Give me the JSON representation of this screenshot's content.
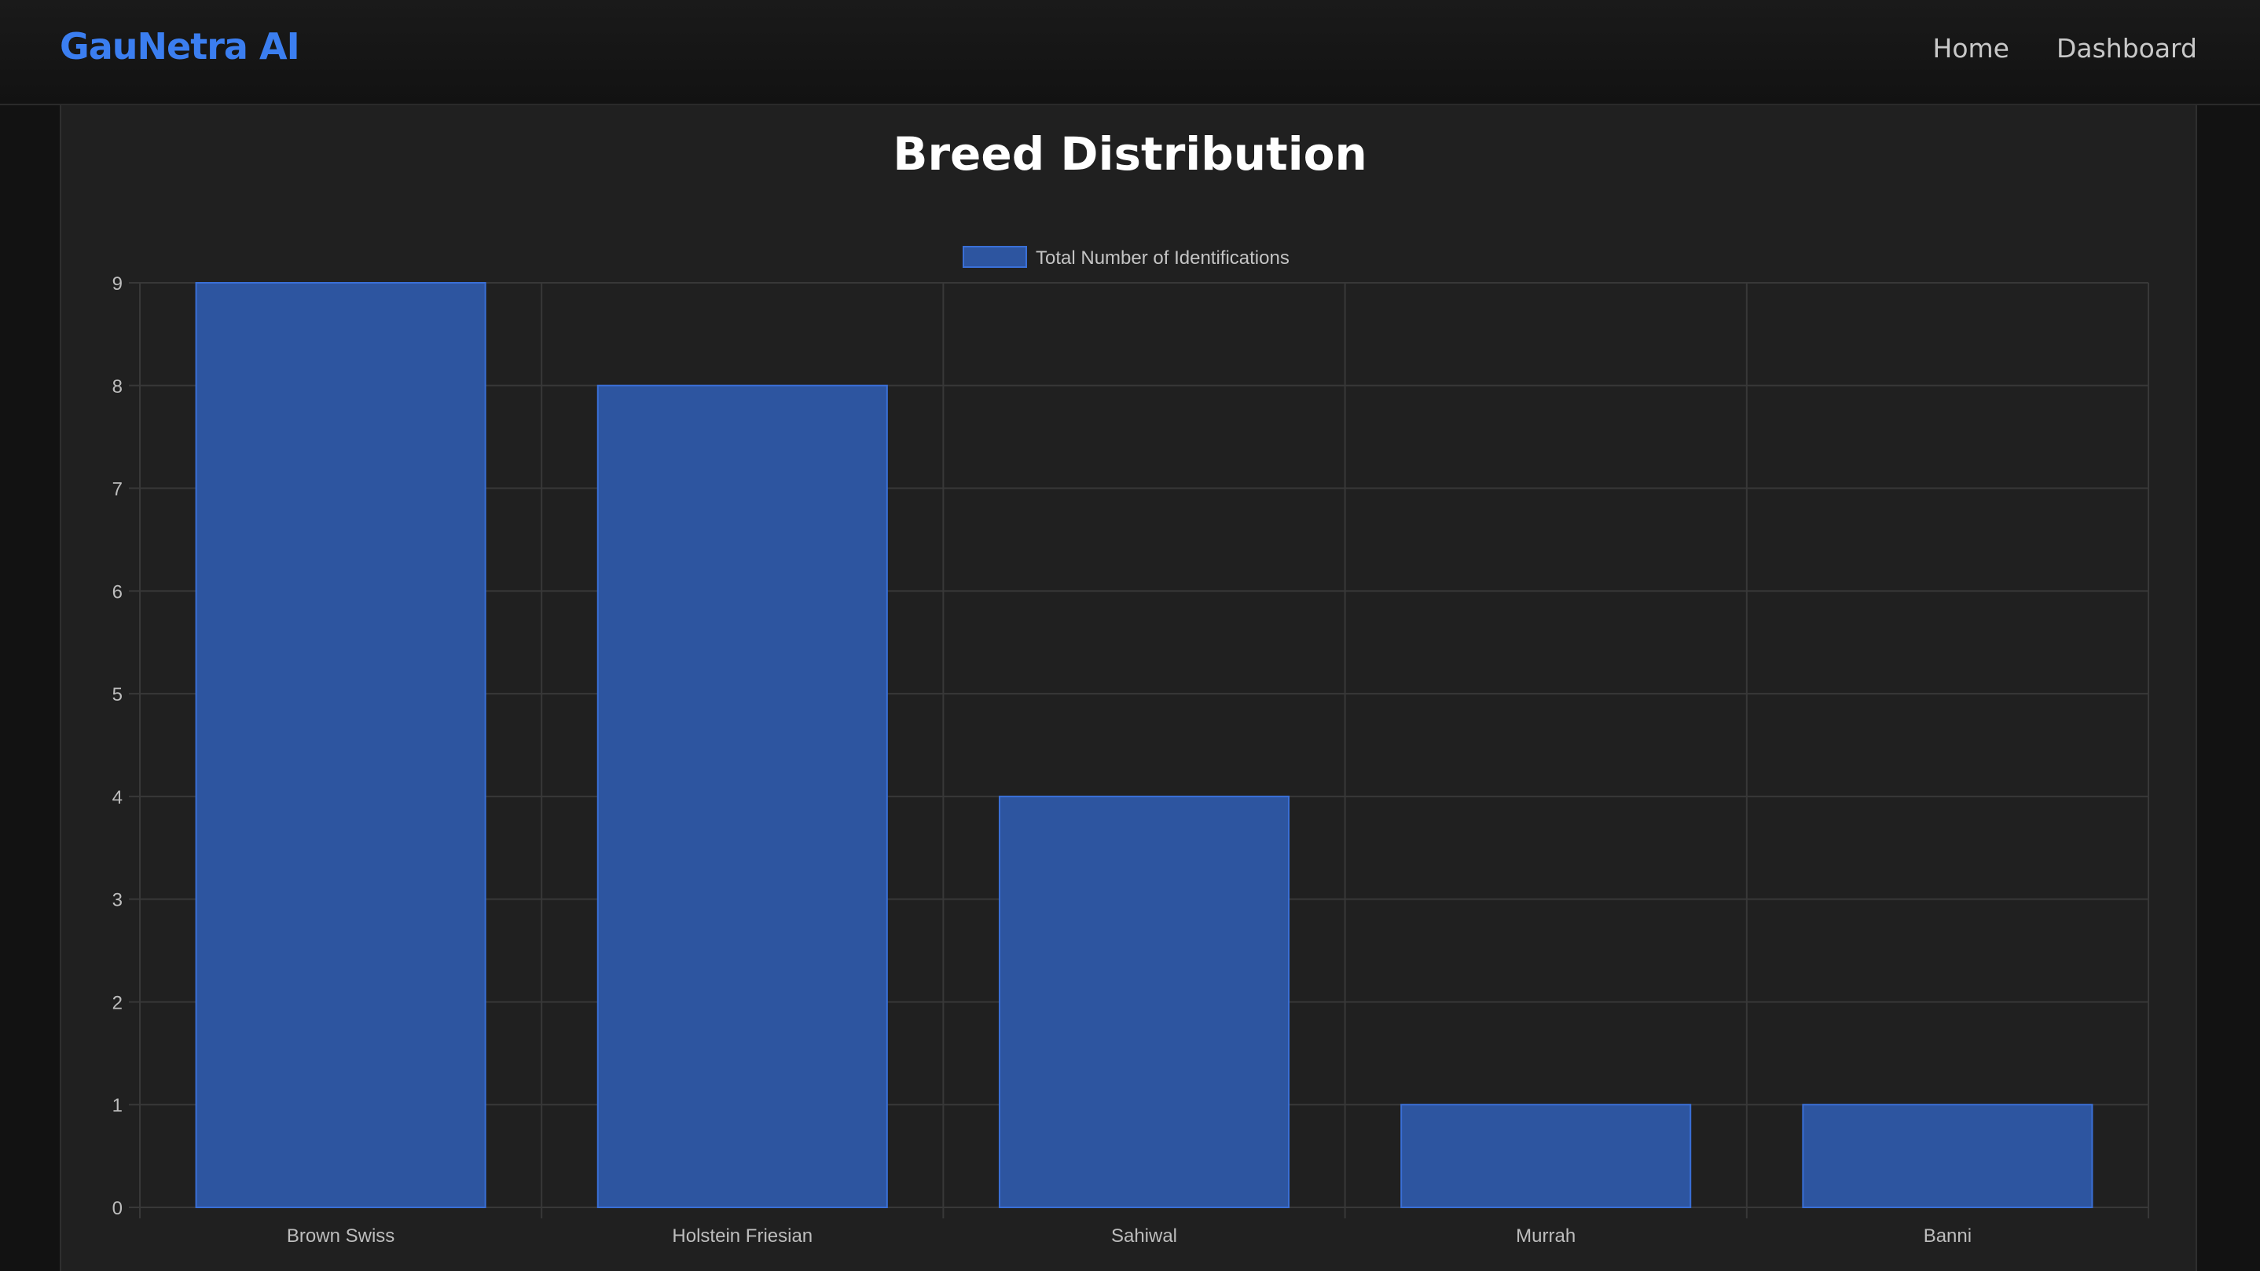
{
  "app": {
    "brand": "GauNetra AI"
  },
  "nav": {
    "items": [
      "Home",
      "Dashboard"
    ]
  },
  "page": {
    "title": "Breed Distribution"
  },
  "colors": {
    "accent": "#3b7ef0",
    "bar_fill": "#2d55a0",
    "bar_border": "#3a6fd6",
    "panel_bg": "#202020",
    "page_bg": "#121212"
  },
  "chart_data": {
    "type": "bar",
    "categories": [
      "Brown Swiss",
      "Holstein Friesian",
      "Sahiwal",
      "Murrah",
      "Banni"
    ],
    "series": [
      {
        "name": "Total Number of Identifications",
        "values": [
          9,
          8,
          4,
          1,
          1
        ]
      }
    ],
    "ylim": [
      0,
      9
    ],
    "yticks": [
      0,
      1,
      2,
      3,
      4,
      5,
      6,
      7,
      8,
      9
    ],
    "grid": true,
    "legend": "top-center"
  }
}
